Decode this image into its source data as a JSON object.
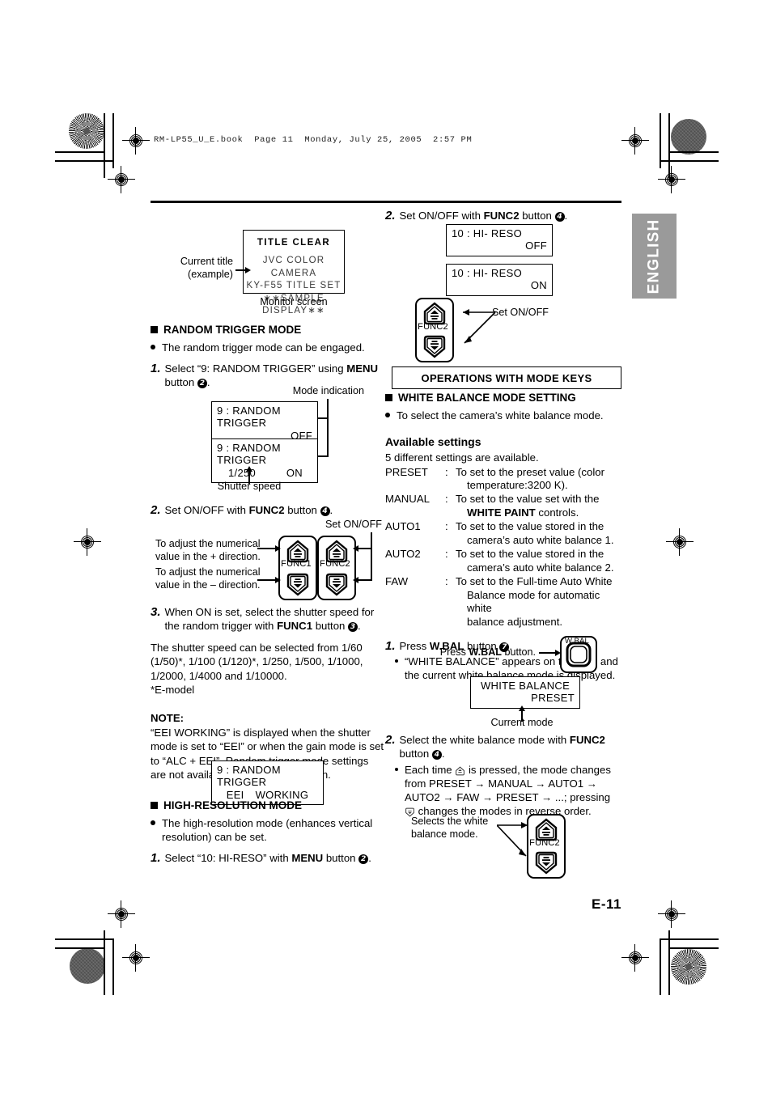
{
  "print_header": "RM-LP55_U_E.book  Page 11  Monday, July 25, 2005  2:57 PM",
  "language_tab": "ENGLISH",
  "page_number": "E-11",
  "left_column": {
    "monitor_diagram": {
      "title": "TITLE CLEAR",
      "lines": [
        "JVC COLOR CAMERA",
        "KY-F55 TITLE SET",
        "∗∗SAMPLE DISPLAY∗∗"
      ],
      "left_caption_line1": "Current title",
      "left_caption_line2": "(example)",
      "bottom_caption": "Monitor screen"
    },
    "random_trigger": {
      "heading": "RANDOM TRIGGER MODE",
      "bullet": "The random trigger mode can be engaged.",
      "step1_num": "1.",
      "step1_a": "Select “9: RANDOM TRIGGER” using ",
      "step1_bold": "MENU",
      "step1_b": " button ",
      "step1_circle": "2",
      "step1_end": ".",
      "callout_mode": "Mode indication",
      "callout_shutter": "Shutter speed",
      "lcd1_line1": "9 : RANDOM TRIGGER",
      "lcd1_line2": "OFF",
      "lcd2_line1": "9 : RANDOM TRIGGER",
      "lcd2_left": "1/250",
      "lcd2_right": "ON",
      "step2_num": "2.",
      "step2_a": "Set ON/OFF with ",
      "step2_bold": "FUNC2",
      "step2_b": " button ",
      "step2_circle": "4",
      "step2_end": ".",
      "keys_callout_top": "Set ON/OFF",
      "keys_callout_plus_l1": "To adjust the numerical",
      "keys_callout_plus_l2": "value in the + direction.",
      "keys_callout_minus_l1": "To adjust the numerical",
      "keys_callout_minus_l2": "value in the – direction.",
      "key1_label": "FUNC1",
      "key2_label": "FUNC2",
      "step3_num": "3.",
      "step3_a": "When ON is set, select the shutter speed for the random trigger with ",
      "step3_bold": "FUNC1",
      "step3_b": " button ",
      "step3_circle": "3",
      "step3_end": ".",
      "shutter_paragraph": "The shutter speed can be selected from 1/60 (1/50)*, 1/100 (1/120)*, 1/250, 1/500, 1/1000, 1/2000, 1/4000 and 1/10000.",
      "emodel_note": "*E-model",
      "note_label": "NOTE:",
      "note_text": "“EEI WORKING” is displayed when the shutter mode is set to “EEI” or when the gain mode is set to “ALC + EEI”. Random trigger mode settings are not available when the “EEI” is on.",
      "lcd3_line1": "9 : RANDOM TRIGGER",
      "lcd3_left": "EEI",
      "lcd3_right": "WORKING"
    },
    "high_resolution": {
      "heading": "HIGH-RESOLUTION MODE",
      "bullet": "The high-resolution mode (enhances vertical resolution) can be set.",
      "step1_num": "1.",
      "step1_a": "Select “10: HI-RESO” with ",
      "step1_bold": "MENU",
      "step1_b": " button ",
      "step1_circle": "2",
      "step1_end": "."
    }
  },
  "right_column": {
    "hireso_step": {
      "num": "2.",
      "a": "Set ON/OFF with ",
      "bold": "FUNC2",
      "b": " button ",
      "circle": "4",
      "end": ".",
      "lcd_off_line1": "10 : HI- RESO",
      "lcd_off_line2": "OFF",
      "lcd_on_line1": "10 : HI- RESO",
      "lcd_on_line2": "ON",
      "key_label": "FUNC2",
      "callout": "Set ON/OFF"
    },
    "section_box": "OPERATIONS WITH MODE KEYS",
    "white_balance": {
      "heading": "WHITE BALANCE MODE SETTING",
      "bullet": "To select the camera’s white balance mode.",
      "available_title": "Available settings",
      "available_intro": "5 different settings are available.",
      "settings": [
        {
          "key": "PRESET",
          "colon": ":",
          "line1": "To set to the preset value (color",
          "line2": "temperature:3200 K)."
        },
        {
          "key": "MANUAL",
          "colon": ":",
          "line1": "To set to the value set with the",
          "line2_bold": "WHITE PAINT",
          "line2_rest": " controls."
        },
        {
          "key": "AUTO1",
          "colon": ":",
          "line1": "To set to the value stored in the",
          "line2": "camera’s auto white balance 1."
        },
        {
          "key": "AUTO2",
          "colon": ":",
          "line1": "To set to the value stored in the",
          "line2": "camera’s auto white balance 2."
        },
        {
          "key": "FAW",
          "colon": ":",
          "line1": "To set to the Full-time Auto White",
          "line2": "Balance mode for automatic white",
          "line3": "balance adjustment."
        }
      ],
      "step1_num": "1.",
      "step1_a": "Press ",
      "step1_bold": "W.BAL",
      "step1_b": " button ",
      "step1_circle": "7",
      "step1_end": ".",
      "step1_sub_a": "“WHITE BALANCE” appears on the LCD and the current white balance mode is displayed.",
      "press_callout_a": "Press ",
      "press_callout_bold": "W.BAL",
      "press_callout_b": " button.",
      "wbal_key_label": "W.BAL",
      "lcd_line1": "WHITE BALANCE",
      "lcd_line2": "PRESET",
      "current_mode_caption": "Current mode",
      "step2_num": "2.",
      "step2_a": "Select the white balance mode with ",
      "step2_bold": "FUNC2",
      "step2_b": " button ",
      "step2_circle": "4",
      "step2_end": ".",
      "step2_sub_1": "Each time ",
      "step2_sub_2": " is pressed, the mode changes from PRESET → MANUAL → AUTO1 → AUTO2 → FAW → PRESET → ...; pressing ",
      "step2_sub_3": " changes the modes in reverse order.",
      "selects_callout_l1": "Selects the white",
      "selects_callout_l2": "balance mode.",
      "func2_label": "FUNC2"
    }
  }
}
